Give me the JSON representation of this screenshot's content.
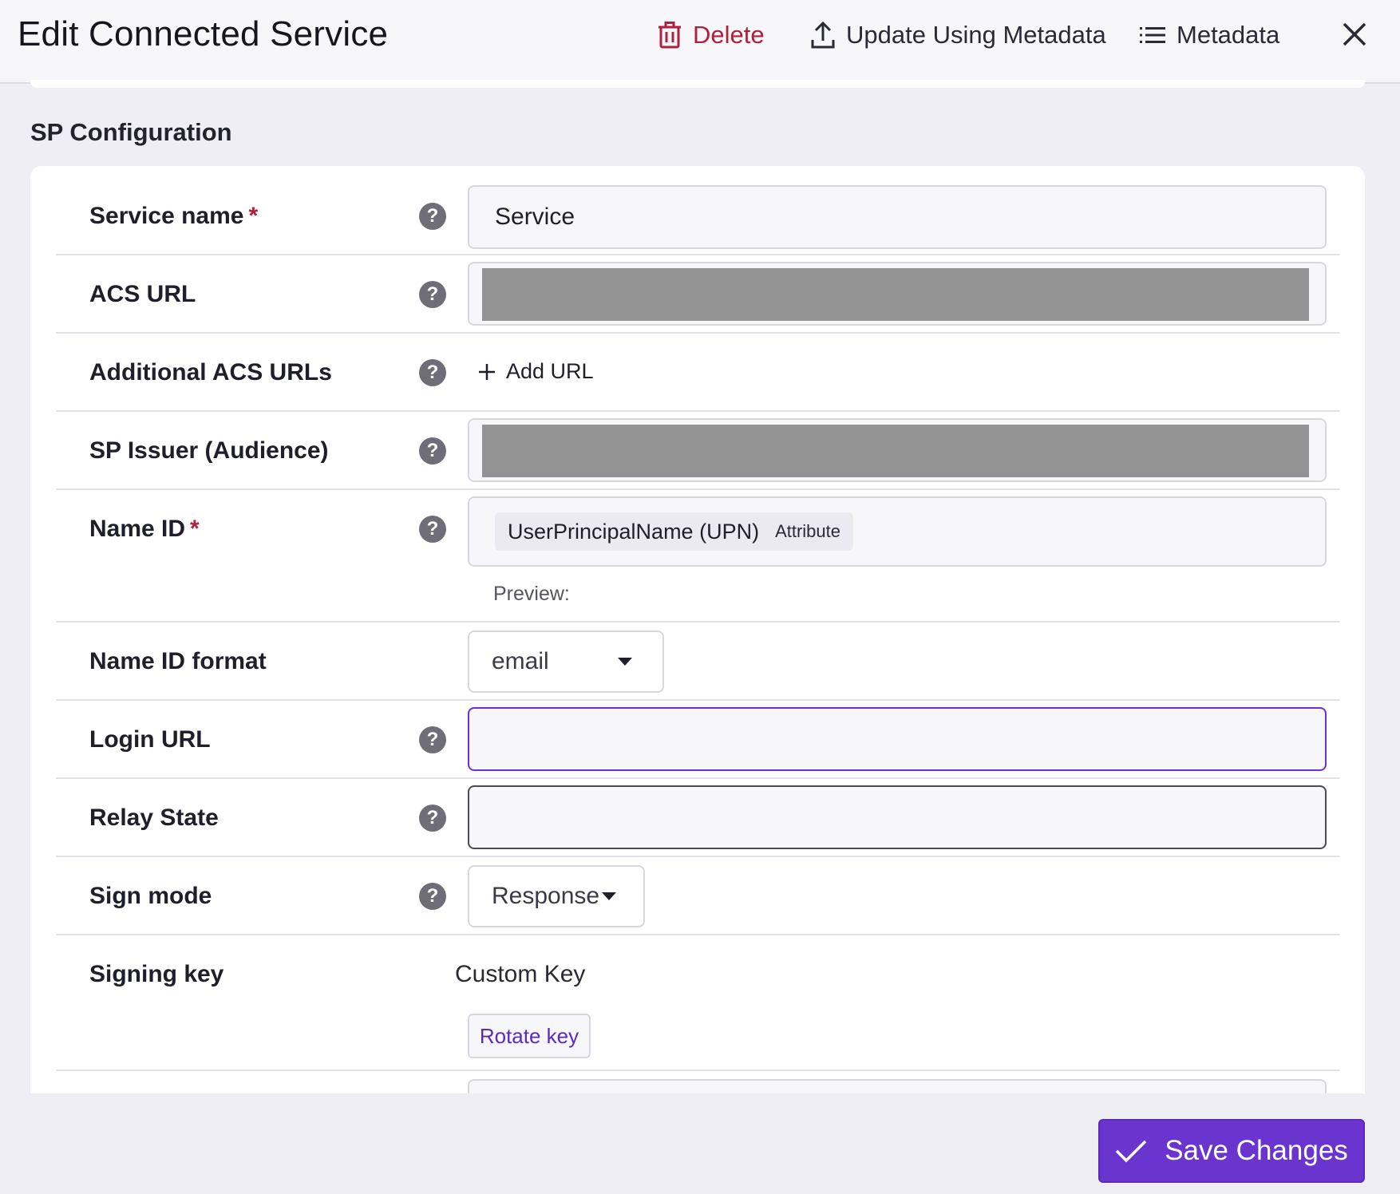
{
  "header": {
    "title": "Edit Connected Service",
    "delete_label": "Delete",
    "update_label": "Update Using Metadata",
    "metadata_label": "Metadata"
  },
  "section": {
    "title": "SP Configuration"
  },
  "fields": {
    "service_name": {
      "label": "Service name",
      "required_mark": "*",
      "value": "Service"
    },
    "acs_url": {
      "label": "ACS URL"
    },
    "additional_acs": {
      "label": "Additional ACS URLs",
      "add_label": "Add URL"
    },
    "sp_issuer": {
      "label": "SP Issuer (Audience)"
    },
    "name_id": {
      "label": "Name ID",
      "required_mark": "*",
      "chip_value": "UserPrincipalName (UPN)",
      "chip_type": "Attribute",
      "preview_label": "Preview:"
    },
    "name_id_format": {
      "label": "Name ID format",
      "value": "email"
    },
    "login_url": {
      "label": "Login URL",
      "value": ""
    },
    "relay_state": {
      "label": "Relay State",
      "value": ""
    },
    "sign_mode": {
      "label": "Sign mode",
      "value": "Response"
    },
    "signing_key": {
      "label": "Signing key",
      "value": "Custom Key",
      "rotate_label": "Rotate key"
    }
  },
  "footer": {
    "save_label": "Save Changes"
  },
  "colors": {
    "accent": "#6a35cf",
    "danger": "#b0203d"
  },
  "icons": {
    "help": "?",
    "delete": "trash-icon",
    "update": "upload-icon",
    "metadata": "list-icon",
    "close": "close-icon",
    "add": "plus-icon",
    "save": "check-icon"
  }
}
